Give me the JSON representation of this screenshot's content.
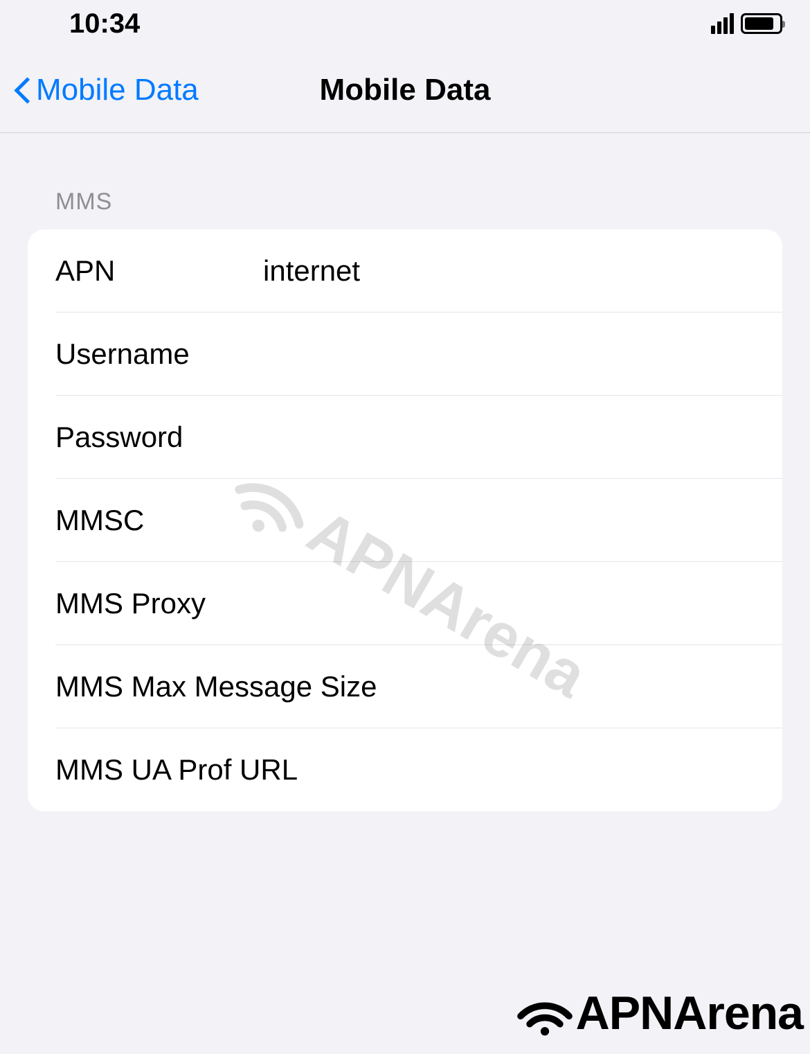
{
  "status_bar": {
    "time": "10:34"
  },
  "nav": {
    "back_label": "Mobile Data",
    "title": "Mobile Data"
  },
  "section": {
    "header": "MMS",
    "rows": {
      "apn": {
        "label": "APN",
        "value": "internet"
      },
      "username": {
        "label": "Username",
        "value": ""
      },
      "password": {
        "label": "Password",
        "value": ""
      },
      "mmsc": {
        "label": "MMSC",
        "value": ""
      },
      "mms_proxy": {
        "label": "MMS Proxy",
        "value": ""
      },
      "mms_max_size": {
        "label": "MMS Max Message Size",
        "value": ""
      },
      "mms_ua_prof": {
        "label": "MMS UA Prof URL",
        "value": ""
      }
    }
  },
  "branding": {
    "watermark": "APNArena",
    "footer": "APNArena"
  }
}
